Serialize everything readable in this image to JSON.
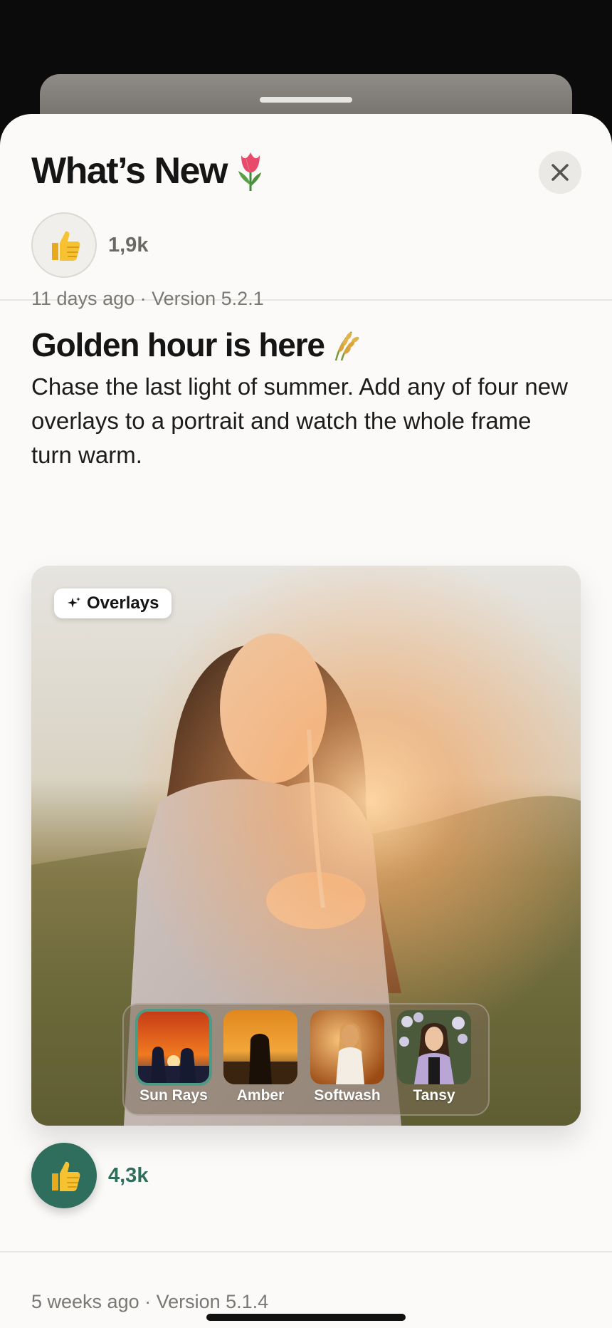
{
  "header": {
    "title": "What’s New",
    "title_emoji_icon": "tulip-icon",
    "close_icon": "close-icon",
    "reaction_count": "1,9k"
  },
  "entries": [
    {
      "meta": "11 days ago · Version 5.2.1",
      "title": "Golden hour is here",
      "title_emoji_icon": "sheaf-of-rice-icon",
      "body": "Chase the last light of summer. Add any of four new overlays to a portrait and watch the whole frame turn warm.",
      "media": {
        "chip_label": "Overlays",
        "chip_icon": "sparkle-icon",
        "overlays": [
          {
            "label": "Sun Rays",
            "selected": true
          },
          {
            "label": "Amber",
            "selected": false
          },
          {
            "label": "Softwash",
            "selected": false
          },
          {
            "label": "Tansy",
            "selected": false
          }
        ]
      },
      "reaction_count": "4,3k"
    },
    {
      "meta": "5 weeks ago · Version 5.1.4"
    }
  ],
  "colors": {
    "accent": "#2f6e5c",
    "selected_outline": "#4f9a84",
    "sheet_bg": "#fbfaf8"
  }
}
